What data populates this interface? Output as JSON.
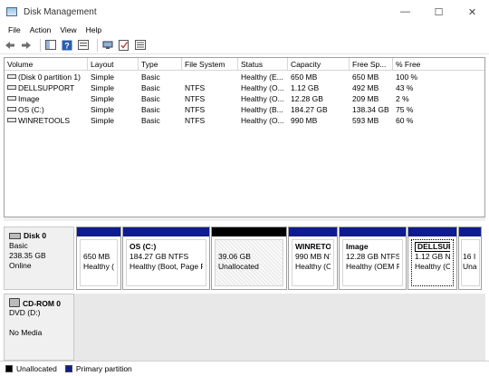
{
  "window": {
    "title": "Disk Management",
    "controls": [
      "—",
      "☐",
      "✕"
    ]
  },
  "menu": [
    "File",
    "Action",
    "View",
    "Help"
  ],
  "toolbar": {
    "icons": [
      "back-arrow-icon",
      "forward-arrow-icon",
      "console-tree-icon",
      "help-icon",
      "properties-icon",
      "connect-icon",
      "check-icon",
      "list-icon"
    ]
  },
  "volume_list": {
    "columns": [
      "Volume",
      "Layout",
      "Type",
      "File System",
      "Status",
      "Capacity",
      "Free Sp...",
      "% Free"
    ],
    "rows": [
      [
        "(Disk 0 partition 1)",
        "Simple",
        "Basic",
        "",
        "Healthy (E...",
        "650 MB",
        "650 MB",
        "100 %"
      ],
      [
        "DELLSUPPORT",
        "Simple",
        "Basic",
        "NTFS",
        "Healthy (O...",
        "1.12 GB",
        "492 MB",
        "43 %"
      ],
      [
        "Image",
        "Simple",
        "Basic",
        "NTFS",
        "Healthy (O...",
        "12.28 GB",
        "209 MB",
        "2 %"
      ],
      [
        "OS (C:)",
        "Simple",
        "Basic",
        "NTFS",
        "Healthy (B...",
        "184.27 GB",
        "138.34 GB",
        "75 %"
      ],
      [
        "WINRETOOLS",
        "Simple",
        "Basic",
        "NTFS",
        "Healthy (O...",
        "990 MB",
        "593 MB",
        "60 %"
      ]
    ]
  },
  "disk0": {
    "name": "Disk 0",
    "type": "Basic",
    "size": "238.35 GB",
    "status": "Online",
    "partitions": [
      {
        "name": "",
        "size": "650 MB",
        "status": "Healthy (EI",
        "kind": "primary"
      },
      {
        "name": "OS  (C:)",
        "size": "184.27 GB NTFS",
        "status": "Healthy (Boot, Page Fil",
        "kind": "primary"
      },
      {
        "name": "",
        "size": "39.06 GB",
        "status": "Unallocated",
        "kind": "unallocated"
      },
      {
        "name": "WINRETOO",
        "size": "990 MB NT",
        "status": "Healthy (OE",
        "kind": "primary"
      },
      {
        "name": "Image",
        "size": "12.28 GB NTFS",
        "status": "Healthy (OEM Pa",
        "kind": "primary"
      },
      {
        "name": "DELLSUPPORT",
        "size": "1.12 GB NTI",
        "status": "Healthy (OE",
        "kind": "primary"
      },
      {
        "name": "",
        "size": "16 I",
        "status": "Una",
        "kind": "primary"
      }
    ]
  },
  "cdrom0": {
    "name": "CD-ROM 0",
    "drive": "DVD (D:)",
    "media": "No Media"
  },
  "legend": [
    {
      "label": "Unallocated",
      "color": "#000000"
    },
    {
      "label": "Primary partition",
      "color": "#0f1c8c"
    }
  ]
}
